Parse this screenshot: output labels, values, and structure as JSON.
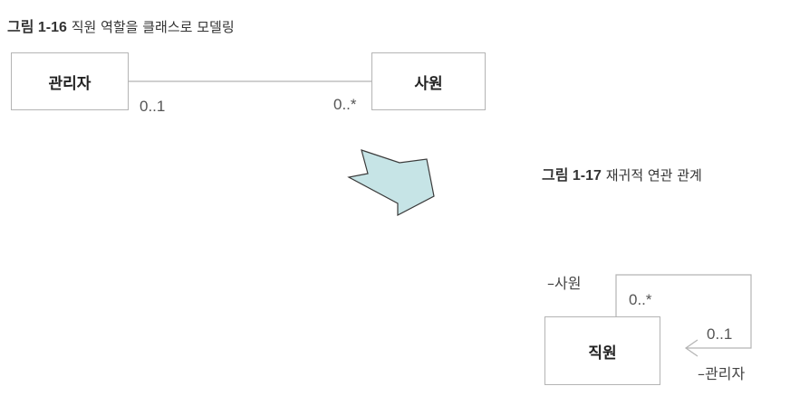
{
  "figure_16": {
    "caption_prefix": "그림",
    "caption_number": "1-16",
    "caption_text": "직원 역할을 클래스로 모델링",
    "left_class": "관리자",
    "right_class": "사원",
    "left_multiplicity": "0..1",
    "right_multiplicity": "0..*"
  },
  "figure_17": {
    "caption_prefix": "그림",
    "caption_number": "1-17",
    "caption_text": "재귀적 연관 관계",
    "class_name": "직원",
    "role_top": "–사원",
    "role_bottom": "–관리자",
    "multiplicity_top": "0..*",
    "multiplicity_right": "0..1"
  },
  "colors": {
    "arrow_fill": "#c6e4e6",
    "arrow_stroke": "#3a3a3a",
    "line": "#b4b4b4"
  }
}
